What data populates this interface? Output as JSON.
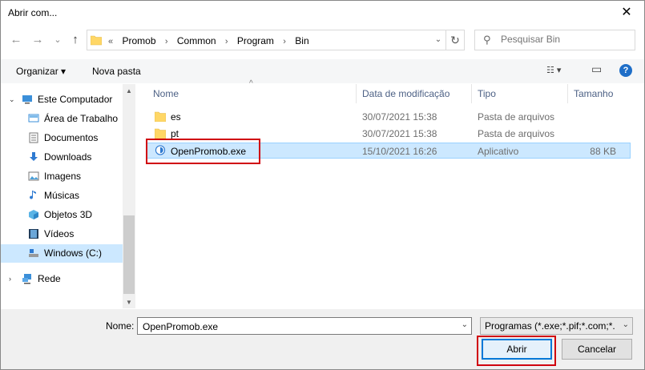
{
  "window": {
    "title": "Abrir com...",
    "close_glyph": "✕"
  },
  "nav_buttons": {
    "back": "←",
    "forward": "→",
    "recent": "⌄",
    "up": "↑"
  },
  "address": {
    "crumbs": [
      "«",
      "Promob",
      "›",
      "Common",
      "›",
      "Program",
      "›",
      "Bin"
    ],
    "dropdown_glyph": "⌄",
    "refresh_glyph": "↻"
  },
  "search": {
    "placeholder": "Pesquisar Bin",
    "icon": "search-icon"
  },
  "toolbar": {
    "organize": "Organizar ▾",
    "new_folder": "Nova pasta",
    "view_glyph": "☷ ▾",
    "preview_glyph": "▭",
    "help_glyph": "?"
  },
  "nav_pane": {
    "items": [
      {
        "label": "Este Computador",
        "icon": "computer-icon"
      },
      {
        "label": "Área de Trabalho",
        "icon": "desktop-icon"
      },
      {
        "label": "Documentos",
        "icon": "documents-icon"
      },
      {
        "label": "Downloads",
        "icon": "download-icon"
      },
      {
        "label": "Imagens",
        "icon": "pictures-icon"
      },
      {
        "label": "Músicas",
        "icon": "music-icon"
      },
      {
        "label": "Objetos 3D",
        "icon": "3d-objects-icon"
      },
      {
        "label": "Vídeos",
        "icon": "videos-icon"
      },
      {
        "label": "Windows (C:)",
        "icon": "drive-icon"
      },
      {
        "label": "Rede",
        "icon": "network-icon"
      }
    ]
  },
  "columns": {
    "name": "Nome",
    "date": "Data de modificação",
    "type": "Tipo",
    "size": "Tamanho",
    "sort_glyph": "^"
  },
  "files": [
    {
      "name": "es",
      "date": "30/07/2021 15:38",
      "type": "Pasta de arquivos",
      "size": "",
      "icon": "folder-icon"
    },
    {
      "name": "pt",
      "date": "30/07/2021 15:38",
      "type": "Pasta de arquivos",
      "size": "",
      "icon": "folder-icon"
    },
    {
      "name": "OpenPromob.exe",
      "date": "15/10/2021 16:26",
      "type": "Aplicativo",
      "size": "88 KB",
      "icon": "application-icon"
    }
  ],
  "bottom": {
    "name_label": "Nome:",
    "name_value": "OpenPromob.exe",
    "filter_value": "Programas (*.exe;*.pif;*.com;*.bat;*.cmd)",
    "open_label": "Abrir",
    "cancel_label": "Cancelar"
  },
  "colors": {
    "selection": "#cce8ff",
    "highlight_box": "#d0000d",
    "accent": "#0078d7"
  }
}
